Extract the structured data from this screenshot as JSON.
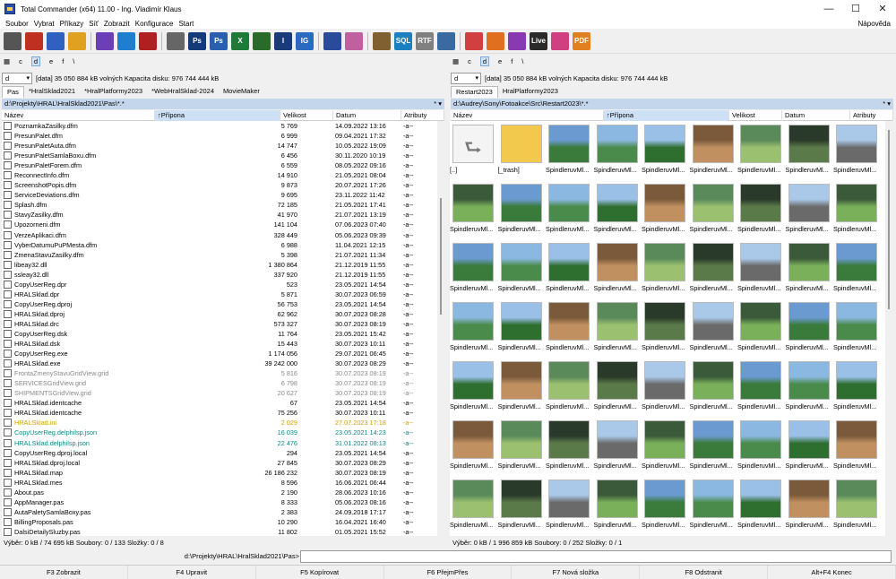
{
  "window": {
    "title": "Total Commander (x64) 11.00 - Ing. Vladimír Klaus"
  },
  "menu": [
    "Soubor",
    "Vybrat",
    "Příkazy",
    "Síť",
    "Zobrazit",
    "Konfigurace",
    "Start"
  ],
  "menu_help": "Nápověda",
  "toolbar_icons": [
    "calculator-icon",
    "puzzle-icon",
    "notepad-icon",
    "wrench-icon",
    "visual-studio-icon",
    "vscode-icon",
    "app-icon",
    "printer-icon",
    "photoshop-icon",
    "photoshop2-icon",
    "excel-icon",
    "app2-icon",
    "inkscape-icon",
    "illustrator-icon",
    "network-icon",
    "grid-icon",
    "clipboard-icon",
    "sql-icon",
    "rtf-icon",
    "window-icon",
    "check-icon",
    "audio-icon",
    "music-icon",
    "live-icon",
    "davinci-icon",
    "pdf-icon"
  ],
  "drives": {
    "left": [
      "c",
      "d",
      "e",
      "f",
      "\\"
    ],
    "right": [
      "c",
      "d",
      "e",
      "f",
      "\\"
    ]
  },
  "left": {
    "drive": "d",
    "info": "[data]  35 050 884 kB volných  Kapacita disku: 976 744 444 kB",
    "tabs": [
      "Pas",
      "*HralSklad2021",
      "*HralPlatformy2023",
      "*WebHralSklad-2024",
      "MovieMaker"
    ],
    "path": "d:\\Projekty\\HRAL\\HralSklad2021\\Pas\\*.*",
    "headers": [
      "Název",
      "Přípona",
      "Velikost",
      "Datum",
      "Atributy"
    ],
    "rows": [
      [
        "PoznamkaZasilky.dfm",
        "5 769",
        "14.09.2022 13:16",
        "-a--",
        ""
      ],
      [
        "PresunPalet.dfm",
        "6 999",
        "09.04.2021 17:32",
        "-a--",
        ""
      ],
      [
        "PresunPaletAuta.dfm",
        "14 747",
        "10.05.2022 19:09",
        "-a--",
        ""
      ],
      [
        "PresunPaletSamlaBoxu.dfm",
        "6 456",
        "30.11.2020 10:19",
        "-a--",
        ""
      ],
      [
        "PresunPaletForem.dfm",
        "6 559",
        "08.05.2022 09:16",
        "-a--",
        ""
      ],
      [
        "ReconnectInfo.dfm",
        "14 910",
        "21.05.2021 08:04",
        "-a--",
        ""
      ],
      [
        "ScreenshotPopis.dfm",
        "9 873",
        "20.07.2021 17:26",
        "-a--",
        ""
      ],
      [
        "ServiceDeviations.dfm",
        "9 695",
        "23.11.2022 11:42",
        "-a--",
        ""
      ],
      [
        "Splash.dfm",
        "72 185",
        "21.05.2021 17:41",
        "-a--",
        ""
      ],
      [
        "StavyZasilky.dfm",
        "41 970",
        "21.07.2021 13:19",
        "-a--",
        ""
      ],
      [
        "Upozorneni.dfm",
        "141 104",
        "07.06.2023 07:40",
        "-a--",
        ""
      ],
      [
        "VerzeAplikaci.dfm",
        "328 449",
        "05.06.2023 09:39",
        "-a--",
        ""
      ],
      [
        "VyberDatumuPuPMesta.dfm",
        "6 988",
        "11.04.2021 12:15",
        "-a--",
        ""
      ],
      [
        "ZmenaStavuZasilky.dfm",
        "5 398",
        "21.07.2021 11:34",
        "-a--",
        ""
      ],
      [
        "libeay32.dll",
        "1 380 864",
        "21.12.2019 11:55",
        "-a--",
        ""
      ],
      [
        "ssleay32.dll",
        "337 920",
        "21.12.2019 11:55",
        "-a--",
        ""
      ],
      [
        "CopyUserReg.dpr",
        "523",
        "23.05.2021 14:54",
        "-a--",
        ""
      ],
      [
        "HRALSklad.dpr",
        "5 871",
        "30.07.2023 06:59",
        "-a--",
        ""
      ],
      [
        "CopyUserReg.dproj",
        "56 753",
        "23.05.2021 14:54",
        "-a--",
        ""
      ],
      [
        "HRALSklad.dproj",
        "62 962",
        "30.07.2023 08:28",
        "-a--",
        ""
      ],
      [
        "HRALSklad.drc",
        "573 327",
        "30.07.2023 08:19",
        "-a--",
        ""
      ],
      [
        "CopyUserReg.dsk",
        "11 764",
        "23.05.2021 15:42",
        "-a--",
        ""
      ],
      [
        "HRALSklad.dsk",
        "15 443",
        "30.07.2023 10:11",
        "-a--",
        ""
      ],
      [
        "CopyUserReg.exe",
        "1 174 056",
        "29.07.2021 06:45",
        "-a--",
        ""
      ],
      [
        "HRALSklad.exe",
        "39 242 000",
        "30.07.2023 08:29",
        "-a--",
        ""
      ],
      [
        "FrontaZmenyStavuGridView.grid",
        "5 816",
        "30.07.2023 08:19",
        "-a--",
        "gray"
      ],
      [
        "SERVICESGridView.grid",
        "6 798",
        "30.07.2023 08:19",
        "-a--",
        "gray"
      ],
      [
        "SHIPMENTSGridView.grid",
        "20 627",
        "30.07.2023 08:19",
        "-a--",
        "gray"
      ],
      [
        "HRALSklad.identcache",
        "67",
        "23.05.2021 14:54",
        "-a--",
        ""
      ],
      [
        "HRALSklad.identcache",
        "75 256",
        "30.07.2023 10:11",
        "-a--",
        ""
      ],
      [
        "HRALSklad.ini",
        "2 029",
        "27.07.2023 17:18",
        "-a--",
        "orange"
      ],
      [
        "CopyUserReg.delphilsp.json",
        "16 039",
        "23.05.2021 14:23",
        "-a--",
        "teal"
      ],
      [
        "HRALSklad.delphilsp.json",
        "22 476",
        "31.01.2022 08:13",
        "-a--",
        "teal"
      ],
      [
        "CopyUserReg.dproj.local",
        "294",
        "23.05.2021 14:54",
        "-a--",
        ""
      ],
      [
        "HRALSklad.dproj.local",
        "27 845",
        "30.07.2023 08:29",
        "-a--",
        ""
      ],
      [
        "HRALSklad.map",
        "26 186 232",
        "30.07.2023 08:19",
        "-a--",
        ""
      ],
      [
        "HRALSklad.mes",
        "8 596",
        "16.06.2021 06:44",
        "-a--",
        ""
      ],
      [
        "About.pas",
        "2 190",
        "28.06.2023 10:16",
        "-a--",
        ""
      ],
      [
        "AppManager.pas",
        "8 333",
        "05.06.2023 08:16",
        "-a--",
        ""
      ],
      [
        "AutaPaletySamlaBoxy.pas",
        "2 383",
        "24.09.2018 17:17",
        "-a--",
        ""
      ],
      [
        "BillingProposals.pas",
        "10 290",
        "16.04.2021 16:40",
        "-a--",
        ""
      ],
      [
        "DalsiDetailySluzby.pas",
        "11 802",
        "01.05.2021 15:52",
        "-a--",
        ""
      ]
    ],
    "status": "Výběr: 0 kB / 74 695 kB  Soubory: 0 / 133  Složky: 0 / 8"
  },
  "right": {
    "drive": "d",
    "info": "[data]  35 050 884 kB volných  Kapacita disku: 976 744 444 kB",
    "tabs": [
      "Restart2023",
      "HralPlatformy2023"
    ],
    "path": "d:\\Audrey\\Sony\\Fotoakce\\Src\\Restart2023\\*.*",
    "headers": [
      "Název",
      "Přípona",
      "Velikost",
      "Datum",
      "Atributy"
    ],
    "thumb_label": "SpindleruvMl...",
    "first_labels": [
      "[..]",
      "[_trash]"
    ],
    "status": "Výběr: 0 kB / 1 996 859 kB  Soubory: 0 / 252  Složky: 0 / 1"
  },
  "cmdline": {
    "label": "d:\\Projekty\\HRAL\\HralSklad2021\\Pas>",
    "value": ""
  },
  "fkeys": [
    "F3 Zobrazit",
    "F4 Upravit",
    "F5 Kopírovat",
    "F6 PřejmPřes",
    "F7 Nová složka",
    "F8 Odstranit",
    "Alt+F4 Konec"
  ]
}
